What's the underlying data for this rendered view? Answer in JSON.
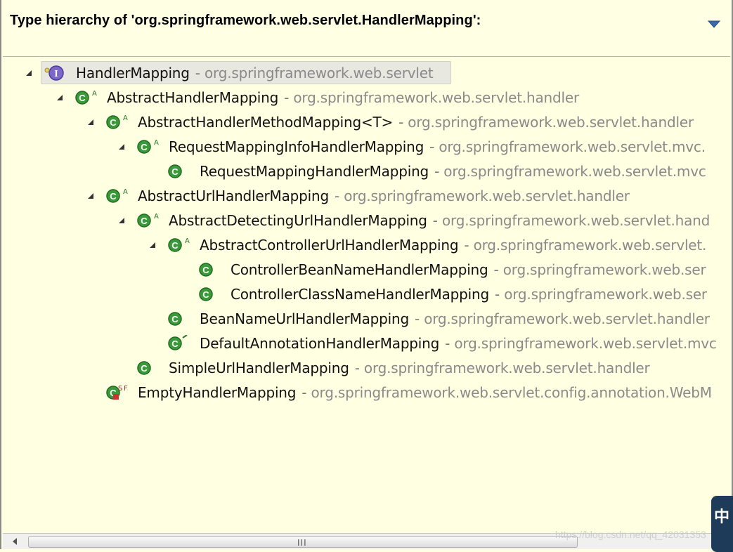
{
  "header": {
    "title": "Type hierarchy of 'org.springframework.web.servlet.HandlerMapping':",
    "menu_icon": "view-menu-icon"
  },
  "colors": {
    "background": "#ffffe1",
    "class_icon": "#3a9a3a",
    "interface_icon": "#6a5acd",
    "package_text": "#8a8a8a"
  },
  "tree": {
    "items": [
      {
        "name": "HandlerMapping",
        "sep": "-",
        "package": "org.springframework.web.servlet",
        "icon": "interface-icon",
        "depth": 0,
        "expanded": true,
        "selected": true
      },
      {
        "name": "AbstractHandlerMapping",
        "sep": "-",
        "package": "org.springframework.web.servlet.handler",
        "icon": "abstract-class-icon",
        "depth": 1,
        "expanded": true
      },
      {
        "name": "AbstractHandlerMethodMapping<T>",
        "sep": "-",
        "package": "org.springframework.web.servlet.handler",
        "icon": "abstract-class-icon",
        "depth": 2,
        "expanded": true
      },
      {
        "name": "RequestMappingInfoHandlerMapping",
        "sep": "-",
        "package": "org.springframework.web.servlet.mvc.",
        "icon": "abstract-class-icon",
        "depth": 3,
        "expanded": true
      },
      {
        "name": "RequestMappingHandlerMapping",
        "sep": "-",
        "package": "org.springframework.web.servlet.mvc",
        "icon": "class-icon",
        "depth": 4,
        "expanded": null
      },
      {
        "name": "AbstractUrlHandlerMapping",
        "sep": "-",
        "package": "org.springframework.web.servlet.handler",
        "icon": "abstract-class-icon",
        "depth": 2,
        "expanded": true
      },
      {
        "name": "AbstractDetectingUrlHandlerMapping",
        "sep": "-",
        "package": "org.springframework.web.servlet.hand",
        "icon": "abstract-class-icon",
        "depth": 3,
        "expanded": true
      },
      {
        "name": "AbstractControllerUrlHandlerMapping",
        "sep": "-",
        "package": "org.springframework.web.servlet.",
        "icon": "abstract-class-icon",
        "depth": 4,
        "expanded": true
      },
      {
        "name": "ControllerBeanNameHandlerMapping",
        "sep": "-",
        "package": "org.springframework.web.ser",
        "icon": "class-icon",
        "depth": 5,
        "expanded": null
      },
      {
        "name": "ControllerClassNameHandlerMapping",
        "sep": "-",
        "package": "org.springframework.web.ser",
        "icon": "class-icon",
        "depth": 5,
        "expanded": null
      },
      {
        "name": "BeanNameUrlHandlerMapping",
        "sep": "-",
        "package": "org.springframework.web.servlet.handler",
        "icon": "class-icon",
        "depth": 4,
        "expanded": null
      },
      {
        "name": "DefaultAnnotationHandlerMapping",
        "sep": "-",
        "package": "org.springframework.web.servlet.mvc",
        "icon": "deprecated-class-icon",
        "depth": 4,
        "expanded": null
      },
      {
        "name": "SimpleUrlHandlerMapping",
        "sep": "-",
        "package": "org.springframework.web.servlet.handler",
        "icon": "class-icon",
        "depth": 3,
        "expanded": null
      },
      {
        "name": "EmptyHandlerMapping",
        "sep": "-",
        "package": "org.springframework.web.servlet.config.annotation.WebM",
        "icon": "static-final-class-icon",
        "depth": 2,
        "expanded": null
      }
    ]
  },
  "scrollbar": {
    "grip": "III"
  },
  "watermark": "https://blog.csdn.net/qq_42031353",
  "badge": {
    "text": "中"
  }
}
